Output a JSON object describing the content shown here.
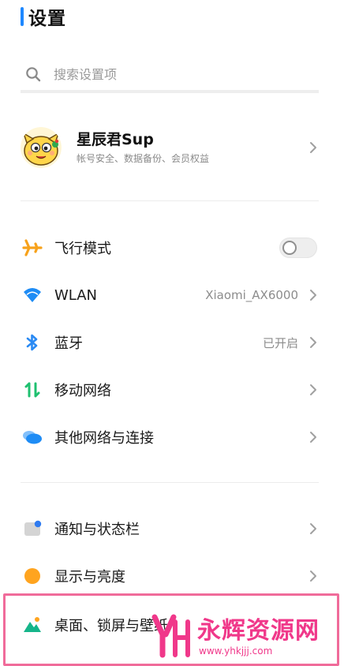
{
  "header": {
    "title": "设置",
    "accent_color": "#1e88ff"
  },
  "search": {
    "placeholder": "搜索设置项",
    "value": "",
    "icon": "search-icon"
  },
  "account": {
    "name": "星辰君Sup",
    "subtitle": "帐号安全、数据备份、会员权益",
    "avatar": "cartoon-avatar"
  },
  "network_section": [
    {
      "label": "飞行模式",
      "icon": "airplane-icon",
      "icon_color": "#f7a21b",
      "control": "toggle",
      "toggle_on": false
    },
    {
      "label": "WLAN",
      "icon": "wifi-icon",
      "icon_color": "#1e8cf5",
      "value": "Xiaomi_AX6000",
      "control": "chevron"
    },
    {
      "label": "蓝牙",
      "icon": "bluetooth-icon",
      "icon_color": "#2a8af3",
      "value": "已开启",
      "control": "chevron"
    },
    {
      "label": "移动网络",
      "icon": "mobile-data-icon",
      "icon_color": "#1fc070",
      "control": "chevron"
    },
    {
      "label": "其他网络与连接",
      "icon": "connection-icon",
      "icon_color": "#1e8cf5",
      "control": "chevron"
    }
  ],
  "display_section": [
    {
      "label": "通知与状态栏",
      "icon": "notification-icon",
      "icon_color": "#c8c8c8",
      "control": "chevron"
    },
    {
      "label": "显示与亮度",
      "icon": "brightness-icon",
      "icon_color": "#ffa41f",
      "control": "chevron"
    },
    {
      "label": "桌面、锁屏与壁纸",
      "icon": "wallpaper-icon",
      "icon_color": "#16b58a",
      "control": "chevron"
    }
  ],
  "highlight_color": "#f06b9a",
  "watermark": {
    "name": "永辉资源网",
    "url": "www.yhkjjj.com",
    "color": "#f0388a"
  }
}
